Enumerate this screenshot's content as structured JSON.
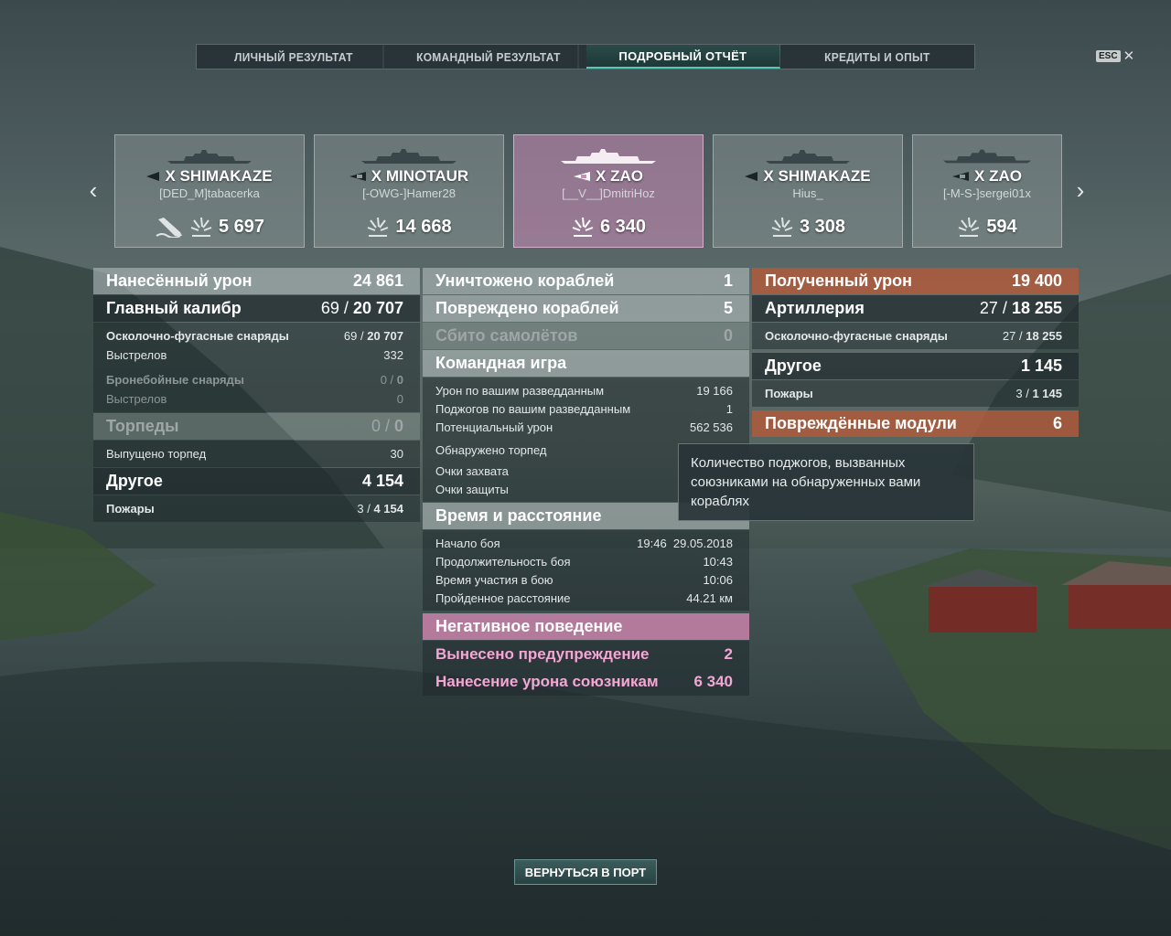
{
  "tabs": [
    {
      "label": "ЛИЧНЫЙ РЕЗУЛЬТАТ",
      "active": false
    },
    {
      "label": "КОМАНДНЫЙ РЕЗУЛЬТАТ",
      "active": false
    },
    {
      "label": "ПОДРОБНЫЙ ОТЧЁТ",
      "active": true
    },
    {
      "label": "КРЕДИТЫ И ОПЫТ",
      "active": false
    }
  ],
  "esc": "ESC",
  "ships": [
    {
      "name": "X SHIMAKAZE",
      "player": "[DED_M]tabacerka",
      "damage": "5 697",
      "type_icon": "destroyer-icon",
      "sunk": true,
      "selected": false
    },
    {
      "name": "X MINOTAUR",
      "player": "[-OWG-]Hamer28",
      "damage": "14 668",
      "type_icon": "cruiser-icon",
      "sunk": false,
      "selected": false
    },
    {
      "name": "X ZAO",
      "player": "[__V__]DmitriHoz",
      "damage": "6 340",
      "type_icon": "cruiser-icon",
      "sunk": false,
      "selected": true
    },
    {
      "name": "X SHIMAKAZE",
      "player": "Hius_",
      "damage": "3 308",
      "type_icon": "destroyer-icon",
      "sunk": false,
      "selected": false
    },
    {
      "name": "X ZAO",
      "player": "[-M-S-]sergei01x",
      "damage": "594",
      "type_icon": "cruiser-icon",
      "sunk": false,
      "selected": false
    }
  ],
  "dealt": {
    "title": "Нанесённый урон",
    "total": "24 861",
    "main_battery": {
      "label": "Главный калибр",
      "hits": "69",
      "damage": "20 707"
    },
    "he": {
      "label": "Осколочно-фугасные снаряды",
      "hits": "69",
      "damage": "20 707"
    },
    "he_shots": {
      "label": "Выстрелов",
      "value": "332"
    },
    "ap": {
      "label": "Бронебойные снаряды",
      "hits": "0",
      "damage": "0"
    },
    "ap_shots": {
      "label": "Выстрелов",
      "value": "0"
    },
    "torpedoes": {
      "label": "Торпеды",
      "hits": "0",
      "damage": "0"
    },
    "torp_fired": {
      "label": "Выпущено торпед",
      "value": "30"
    },
    "other": {
      "label": "Другое",
      "value": "4 154"
    },
    "fires": {
      "label": "Пожары",
      "hits": "3",
      "damage": "4 154"
    }
  },
  "middle": {
    "destroyed": {
      "label": "Уничтожено кораблей",
      "value": "1"
    },
    "damaged": {
      "label": "Повреждено кораблей",
      "value": "5"
    },
    "planes": {
      "label": "Сбито самолётов",
      "value": "0"
    },
    "team": {
      "title": "Командная игра",
      "spot_damage": {
        "label": "Урон по вашим разведданным",
        "value": "19 166"
      },
      "spot_fires": {
        "label": "Поджогов по вашим разведданным",
        "value": "1"
      },
      "potential": {
        "label": "Потенциальный урон",
        "value": "562 536"
      },
      "torp_spotted": {
        "label": "Обнаружено торпед",
        "value": ""
      },
      "capture": {
        "label": "Очки захвата",
        "value": ""
      },
      "defense": {
        "label": "Очки защиты",
        "value": ""
      }
    },
    "time": {
      "title": "Время и расстояние",
      "start": {
        "label": "Начало боя",
        "value": "19:46  29.05.2018"
      },
      "duration": {
        "label": "Продолжительность боя",
        "value": "10:43"
      },
      "participation": {
        "label": "Время участия в бою",
        "value": "10:06"
      },
      "distance": {
        "label": "Пройденное расстояние",
        "value": "44.21 км"
      }
    },
    "negative": {
      "title": "Негативное поведение",
      "warning": {
        "label": "Вынесено предупреждение",
        "value": "2"
      },
      "team_damage": {
        "label": "Нанесение урона союзникам",
        "value": "6 340"
      }
    }
  },
  "received": {
    "title": "Полученный урон",
    "total": "19 400",
    "artillery": {
      "label": "Артиллерия",
      "hits": "27",
      "damage": "18 255"
    },
    "he": {
      "label": "Осколочно-фугасные снаряды",
      "hits": "27",
      "damage": "18 255"
    },
    "other": {
      "label": "Другое",
      "value": "1 145"
    },
    "fires": {
      "label": "Пожары",
      "hits": "3",
      "damage": "1 145"
    },
    "modules": {
      "label": "Повреждённые модули",
      "value": "6"
    }
  },
  "tooltip": "Количество поджогов, вызванных союзниками на обнаруженных вами кораблях",
  "return_button": "ВЕРНУТЬСЯ В ПОРТ",
  "colors": {
    "accent": "#58c8b6",
    "received": "#b05a3c",
    "negative": "#c882aa",
    "selected_card": "#cd8cb9"
  }
}
